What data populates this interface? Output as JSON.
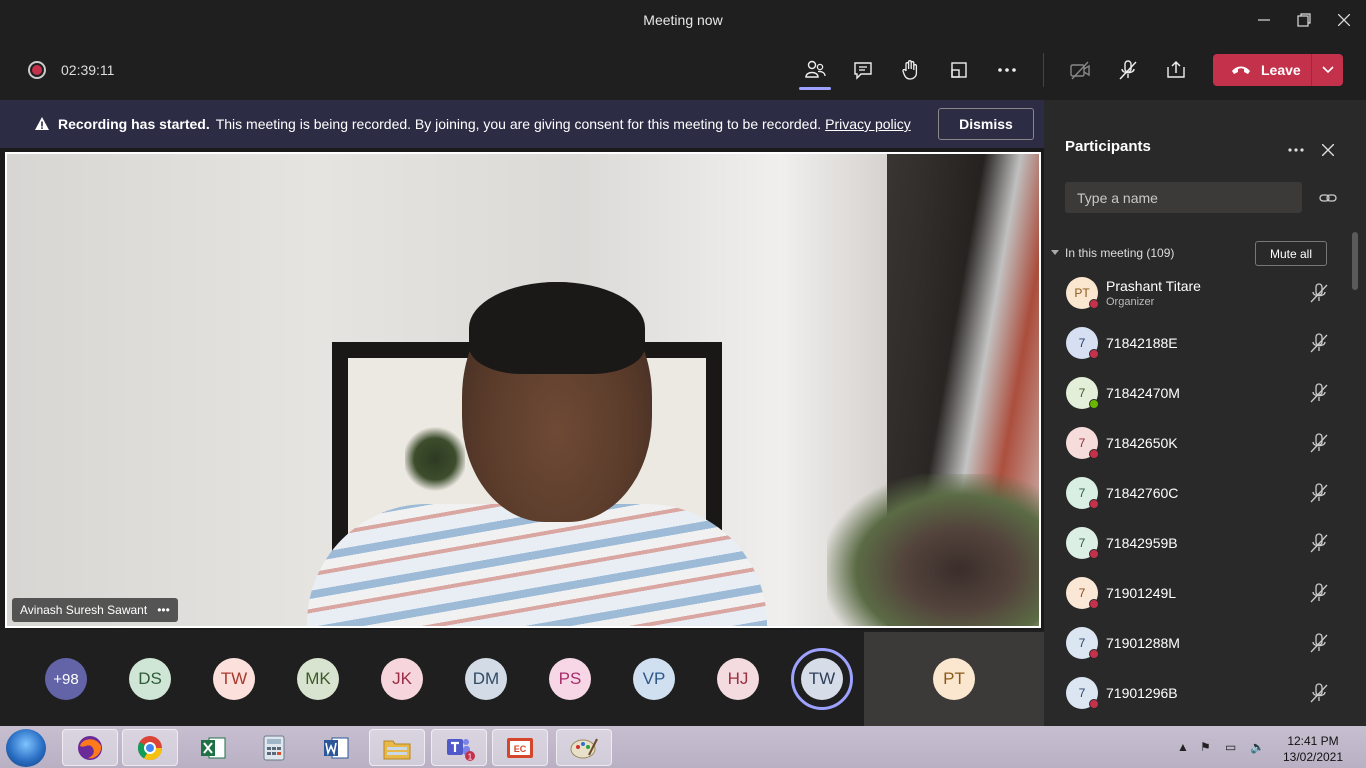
{
  "window": {
    "title": "Meeting now",
    "controls": [
      "minimize",
      "restore",
      "close"
    ]
  },
  "toolbar": {
    "timer": "02:39:11",
    "icons": [
      "participants-icon",
      "chat-icon",
      "raise-hand-icon",
      "share-tray-icon",
      "more-actions-icon",
      "camera-off-icon",
      "mic-off-icon",
      "share-screen-icon"
    ],
    "leave_label": "Leave",
    "accent": "#c4314b"
  },
  "banner": {
    "heading": "Recording has started.",
    "message": "This meeting is being recorded. By joining, you are giving consent for this meeting to be recorded.",
    "link": "Privacy policy",
    "dismiss_label": "Dismiss"
  },
  "video": {
    "speaker_name": "Avinash Suresh Sawant",
    "more": "•••"
  },
  "strip": {
    "overflow": "+98",
    "avatars": [
      {
        "initials": "DS",
        "color": "#cfe5d6",
        "text": "#2f5c3a"
      },
      {
        "initials": "TW",
        "color": "#fbe0dc",
        "text": "#a8392d"
      },
      {
        "initials": "MK",
        "color": "#d9e4d0",
        "text": "#3c5a2a"
      },
      {
        "initials": "JK",
        "color": "#f6d6dc",
        "text": "#9b2c44"
      },
      {
        "initials": "DM",
        "color": "#d3dce6",
        "text": "#2f4a66"
      },
      {
        "initials": "PS",
        "color": "#f7d7e6",
        "text": "#a82c6a"
      },
      {
        "initials": "VP",
        "color": "#d0e0f0",
        "text": "#2c5786"
      },
      {
        "initials": "HJ",
        "color": "#f3dbdf",
        "text": "#9a3040"
      },
      {
        "initials": "TW",
        "color": "#d6dde8",
        "text": "#2e3e58"
      }
    ],
    "tile_initials": "PT"
  },
  "panel": {
    "title": "Participants",
    "search_placeholder": "Type a name",
    "section_label": "In this meeting (109)",
    "mute_all": "Mute all",
    "participants": [
      {
        "initials": "PT",
        "name": "Prashant Titare",
        "role": "Organizer",
        "color": "#fbe7cf",
        "text": "#8a5a1c",
        "status": "#c4314b"
      },
      {
        "initials": "7",
        "name": "71842188E",
        "color": "#d6e0f2",
        "text": "#2c3e6a",
        "status": "#c4314b"
      },
      {
        "initials": "7",
        "name": "71842470M",
        "color": "#e3efd9",
        "text": "#3c5a2a",
        "status": "#6bb700"
      },
      {
        "initials": "7",
        "name": "71842650K",
        "color": "#f7dcdc",
        "text": "#8a2f2f",
        "status": "#c4314b"
      },
      {
        "initials": "7",
        "name": "71842760C",
        "color": "#d9efe3",
        "text": "#2e5c44",
        "status": "#c4314b"
      },
      {
        "initials": "7",
        "name": "71842959B",
        "color": "#dcefe4",
        "text": "#2e5c44",
        "status": "#c4314b"
      },
      {
        "initials": "7",
        "name": "71901249L",
        "color": "#fbe7d6",
        "text": "#8a4a1c",
        "status": "#c4314b"
      },
      {
        "initials": "7",
        "name": "71901288M",
        "color": "#dbe6f2",
        "text": "#2c4466",
        "status": "#c4314b"
      },
      {
        "initials": "7",
        "name": "71901296B",
        "color": "#dbe6f2",
        "text": "#2c4466",
        "status": "#c4314b"
      }
    ]
  },
  "taskbar": {
    "apps": [
      "firefox-icon",
      "chrome-icon",
      "excel-icon",
      "calculator-icon",
      "word-icon",
      "file-explorer-icon",
      "teams-icon",
      "screen-recorder-icon",
      "paint-icon"
    ],
    "teams_badge": "1",
    "time": "12:41 PM",
    "date": "13/02/2021"
  }
}
